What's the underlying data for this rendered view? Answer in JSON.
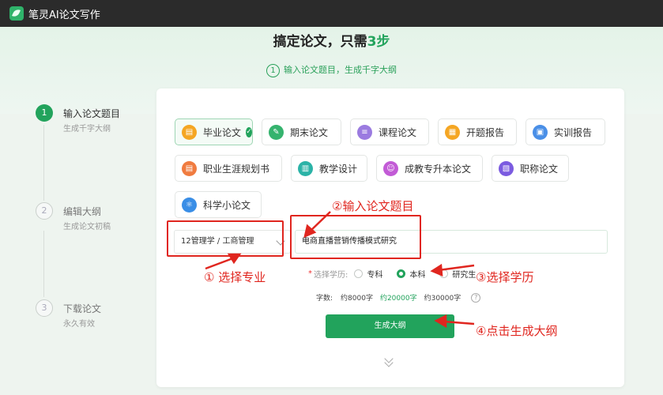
{
  "app": {
    "title": "笔灵AI论文写作"
  },
  "header": {
    "headline_prefix": "搞定论文，只需",
    "headline_accent": "3步",
    "subtitle_num": "1",
    "subtitle_text": "输入论文题目，生成千字大纲"
  },
  "steps": [
    {
      "num": "1",
      "title": "输入论文题目",
      "desc": "生成千字大纲",
      "active": true
    },
    {
      "num": "2",
      "title": "编辑大纲",
      "desc": "生成论文初稿",
      "active": false
    },
    {
      "num": "3",
      "title": "下载论文",
      "desc": "永久有效",
      "active": false
    }
  ],
  "paper_types": [
    {
      "label": "毕业论文",
      "icon": "graduation-paper-icon",
      "color": "#f5a623",
      "selected": true
    },
    {
      "label": "期末论文",
      "icon": "pen-icon",
      "color": "#35b36e",
      "selected": false
    },
    {
      "label": "课程论文",
      "icon": "list-icon",
      "color": "#9b7be0",
      "selected": false
    },
    {
      "label": "开题报告",
      "icon": "report-icon",
      "color": "#f5a623",
      "selected": false
    },
    {
      "label": "实训报告",
      "icon": "training-icon",
      "color": "#4a8fe7",
      "selected": false
    },
    {
      "label": "职业生涯规划书",
      "icon": "career-icon",
      "color": "#f07b3f",
      "selected": false
    },
    {
      "label": "教学设计",
      "icon": "teaching-icon",
      "color": "#2bb3a7",
      "selected": false
    },
    {
      "label": "成教专升本论文",
      "icon": "adult-edu-icon",
      "color": "#c25bd6",
      "selected": false
    },
    {
      "label": "职称论文",
      "icon": "title-paper-icon",
      "color": "#7b5be0",
      "selected": false
    },
    {
      "label": "科学小论文",
      "icon": "science-icon",
      "color": "#3a8ee6",
      "selected": false
    }
  ],
  "form": {
    "major_value": "12管理学 / 工商管理",
    "title_value": "电商直播营销传播模式研究",
    "education_label": "选择学历:",
    "education_options": [
      {
        "label": "专科",
        "selected": false
      },
      {
        "label": "本科",
        "selected": true
      },
      {
        "label": "研究生",
        "selected": false
      }
    ],
    "wordcount_label": "字数:",
    "wordcount_options": [
      {
        "label": "约8000字",
        "selected": false
      },
      {
        "label": "约20000字",
        "selected": true
      },
      {
        "label": "约30000字",
        "selected": false
      }
    ],
    "help_glyph": "?",
    "generate_label": "生成大纲"
  },
  "annotations": {
    "a1": "① 选择专业",
    "a2": "②输入论文题目",
    "a3": "③选择学历",
    "a4": "④点击生成大纲",
    "color": "#e0261f"
  }
}
